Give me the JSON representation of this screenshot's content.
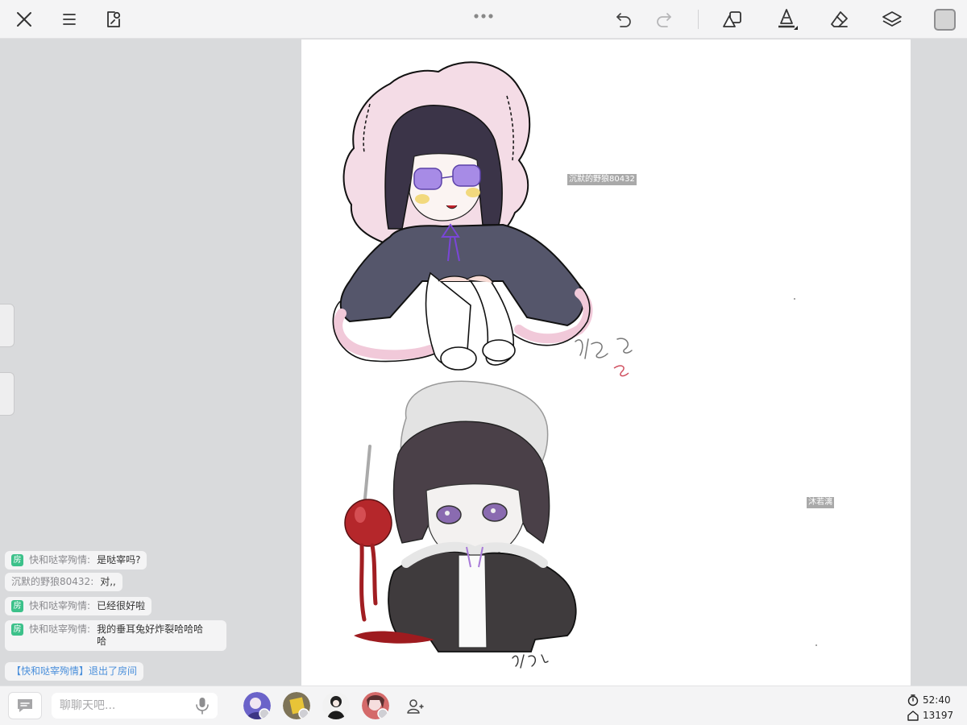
{
  "toolbar": {
    "left_icons": [
      "close-icon",
      "menu-icon",
      "canvas-edit-icon"
    ],
    "right_icons": [
      "undo-icon",
      "redo-icon",
      "shapes-icon",
      "pen-tool-icon",
      "eraser-icon",
      "layers-icon"
    ],
    "current_color": "#d4d4d4"
  },
  "canvas": {
    "user_tags": [
      "沉默的野狼80432",
      "沐若漓"
    ],
    "artwork": {
      "top_figure_hood_color": "#f4dce6",
      "top_figure_cloak_color": "#55566b",
      "bottom_figure_hat_color": "#e3e3e3",
      "bottom_figure_coat_color": "#3f3b3d",
      "apple_color": "#b5272b"
    }
  },
  "chat": {
    "messages": [
      {
        "room": "房",
        "sender": "快和哒宰殉情",
        "colon": ":",
        "text": "是哒宰吗?"
      },
      {
        "room": "",
        "sender": "沉默的野狼80432",
        "colon": ":",
        "text": "对,,"
      },
      {
        "room": "房",
        "sender": "快和哒宰殉情",
        "colon": ":",
        "text": "已经很好啦"
      },
      {
        "room": "房",
        "sender": "快和哒宰殉情",
        "colon": ":",
        "text": "我的垂耳兔好炸裂哈哈哈哈"
      }
    ],
    "system_message": "【快和哒宰殉情】退出了房间"
  },
  "bottombar": {
    "input_placeholder": "聊聊天吧...",
    "input_value": "",
    "timer": "52:40",
    "home_count": "13197"
  }
}
